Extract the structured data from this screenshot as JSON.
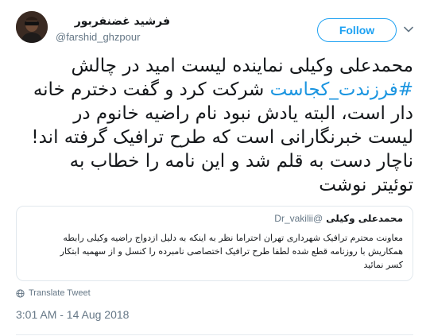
{
  "header": {
    "display_name": "فرشید غضنفربور",
    "screen_name": "@farshid_ghzpour",
    "follow_label": "Follow",
    "chevron_icon": "chevron-down-icon",
    "avatar_icon": "avatar"
  },
  "tweet": {
    "line1": "محمدعلی وکیلی نماینده لیست امید در چالش",
    "hashtag": "#فرزندت_کجاست",
    "line2_rest": " شرکت کرد و گفت دخترم خانه",
    "line3": "دار است، البته یادش نبود نام راضیه خانوم در",
    "line4": "لیست خبرنگارانی است که طرح ترافیک گرفته اند!",
    "line5": "ناچار دست به قلم شد و این نامه را خطاب به",
    "line6": "توئیتر نوشت"
  },
  "quote": {
    "name": "محمدعلی وکیلی",
    "handle": "@Dr_vakilii",
    "line1": "معاونت محترم ترافیک شهرداری تهران احتراما نظر به اینکه به دلیل ازدواج راضیه وکیلی رابطه",
    "line2": "همکاریش با روزنامه قطع شده لطفا طرح ترافیک اختصاصی نامبرده را کنسل و از سهمیه ابتکار",
    "line3": "کسر نمائید"
  },
  "translate": {
    "label": "Translate Tweet",
    "icon": "globe-icon"
  },
  "timestamp": "3:01 AM - 14 Aug 2018",
  "colors": {
    "accent": "#1da1f2",
    "hashtag": "#1b95e0",
    "muted": "#657786",
    "text": "#14171a"
  }
}
